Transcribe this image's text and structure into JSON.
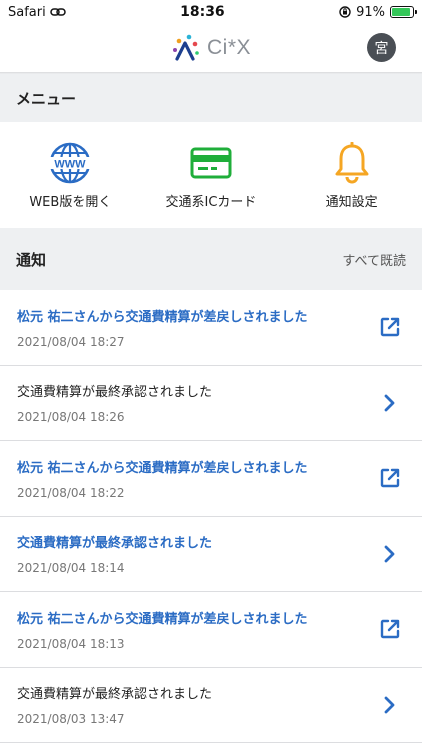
{
  "status_bar": {
    "carrier": "Safari",
    "time": "18:36",
    "battery_percent": "91%",
    "battery_level": 0.91
  },
  "header": {
    "logo_text": "Ci*X",
    "avatar_text": "宮"
  },
  "menu": {
    "title": "メニュー",
    "items": [
      {
        "label": "WEB版を開く",
        "icon": "globe-www-icon"
      },
      {
        "label": "交通系ICカード",
        "icon": "ic-card-icon"
      },
      {
        "label": "通知設定",
        "icon": "bell-icon"
      }
    ]
  },
  "notifications": {
    "title": "通知",
    "mark_all_read": "すべて既読",
    "items": [
      {
        "title": "松元 祐二さんから交通費精算が差戻しされました",
        "date": "2021/08/04 18:27",
        "type": "link",
        "action_icon": "external-link-icon"
      },
      {
        "title": "交通費精算が最終承認されました",
        "date": "2021/08/04 18:26",
        "type": "plain",
        "action_icon": "chevron-right-icon"
      },
      {
        "title": "松元 祐二さんから交通費精算が差戻しされました",
        "date": "2021/08/04 18:22",
        "type": "link",
        "action_icon": "external-link-icon"
      },
      {
        "title": "交通費精算が最終承認されました",
        "date": "2021/08/04 18:14",
        "type": "link",
        "action_icon": "chevron-right-icon"
      },
      {
        "title": "松元 祐二さんから交通費精算が差戻しされました",
        "date": "2021/08/04 18:13",
        "type": "link",
        "action_icon": "external-link-icon"
      },
      {
        "title": "交通費精算が最終承認されました",
        "date": "2021/08/03 13:47",
        "type": "plain",
        "action_icon": "chevron-right-icon"
      }
    ]
  },
  "colors": {
    "link_blue": "#2b6cc4",
    "card_green": "#1fae3a",
    "bell_orange": "#f5a623",
    "section_bg": "#eef0f2"
  }
}
